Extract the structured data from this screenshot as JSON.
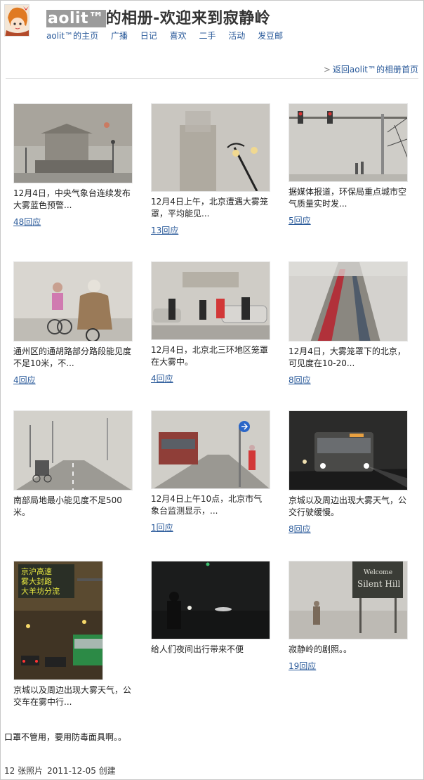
{
  "header": {
    "username": "aolit™",
    "title_suffix": "的相册-欢迎来到寂静岭",
    "nav": [
      {
        "label": "aolit™的主页"
      },
      {
        "label": "广播"
      },
      {
        "label": "日记"
      },
      {
        "label": "喜欢"
      },
      {
        "label": "二手"
      },
      {
        "label": "活动"
      },
      {
        "label": "发豆邮"
      }
    ],
    "back_arrow": ">",
    "back_link": "返回aolit™的相册首页"
  },
  "photos": [
    {
      "caption": "12月4日，中央气象台连续发布大雾蓝色预警...",
      "replies": "48回应",
      "icon": "tiananmen-fog-photo"
    },
    {
      "caption": "12月4日上午，北京遭遇大雾笼罩，平均能见...",
      "replies": "13回应",
      "icon": "foggy-tower-photo"
    },
    {
      "caption": "据媒体报道，环保局重点城市空气质量实时发...",
      "replies": "5回应",
      "icon": "traffic-light-fog-photo"
    },
    {
      "caption": "通州区的通胡路部分路段能见度不足10米，不...",
      "replies": "4回应",
      "icon": "cyclist-mask-photo"
    },
    {
      "caption": "12月4日，北京北三环地区笼罩在大雾中。",
      "replies": "4回应",
      "icon": "pedestrians-fog-photo"
    },
    {
      "caption": "12月4日，大雾笼罩下的北京，可见度在10-20...",
      "replies": "8回应",
      "icon": "skyscraper-fog-photo"
    },
    {
      "caption": "南部局地最小能见度不足500米。",
      "replies": "",
      "icon": "road-fog-photo"
    },
    {
      "caption": "12月4日上午10点，北京市气象台监测显示，...",
      "replies": "1回应",
      "icon": "truck-fog-photo"
    },
    {
      "caption": "京城以及周边出现大雾天气，公交行驶缓慢。",
      "replies": "8回应",
      "icon": "bus-night-photo"
    },
    {
      "caption": "京城以及周边出现大雾天气，公交车在雾中行...",
      "replies": "",
      "icon": "highway-sign-photo",
      "sign": [
        "京沪高速",
        "雾大封路",
        "大羊坊分流"
      ]
    },
    {
      "caption": "给人们夜间出行带来不便",
      "replies": "",
      "icon": "dark-night-photo"
    },
    {
      "caption": "寂静岭的剧照。。",
      "replies": "19回应",
      "icon": "silent-hill-photo",
      "sign": [
        "Welcome",
        "Silent Hill"
      ]
    }
  ],
  "description": "口罩不管用，要用防毒面具啊。。",
  "footer": {
    "count": "12 张照片",
    "created": "2011-12-05 创建"
  },
  "colors": {
    "link": "#2a5a9a",
    "title_highlight": "#9b9b9b"
  }
}
